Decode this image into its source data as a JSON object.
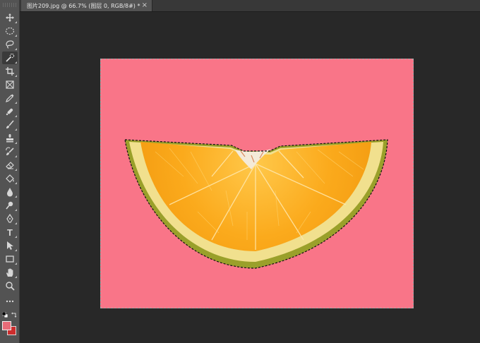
{
  "app": {
    "document_tab": {
      "title": "图片209.jpg @ 66.7% (图层 0, RGB/8#) *",
      "close_glyph": "×"
    }
  },
  "toolbar": {
    "tools": [
      {
        "name": "move-tool",
        "icon": "move-icon",
        "active": false
      },
      {
        "name": "elliptical-marquee-tool",
        "icon": "ellipse-marquee-icon",
        "active": false
      },
      {
        "name": "lasso-tool",
        "icon": "lasso-icon",
        "active": false
      },
      {
        "name": "quick-selection-tool",
        "icon": "quick-selection-icon",
        "active": true
      },
      {
        "name": "crop-tool",
        "icon": "crop-icon",
        "active": false
      },
      {
        "name": "frame-tool",
        "icon": "frame-icon",
        "active": false
      },
      {
        "name": "eyedropper-tool",
        "icon": "eyedropper-icon",
        "active": false
      },
      {
        "name": "healing-brush-tool",
        "icon": "healing-brush-icon",
        "active": false
      },
      {
        "name": "brush-tool",
        "icon": "brush-icon",
        "active": false
      },
      {
        "name": "clone-stamp-tool",
        "icon": "stamp-icon",
        "active": false
      },
      {
        "name": "history-brush-tool",
        "icon": "history-brush-icon",
        "active": false
      },
      {
        "name": "eraser-tool",
        "icon": "eraser-icon",
        "active": false
      },
      {
        "name": "paint-bucket-tool",
        "icon": "paint-bucket-icon",
        "active": false
      },
      {
        "name": "blur-tool",
        "icon": "drop-icon",
        "active": false
      },
      {
        "name": "dodge-tool",
        "icon": "dodge-icon",
        "active": false
      },
      {
        "name": "pen-tool",
        "icon": "pen-icon",
        "active": false
      },
      {
        "name": "type-tool",
        "icon": "type-icon",
        "active": false
      },
      {
        "name": "path-selection-tool",
        "icon": "arrow-icon",
        "active": false
      },
      {
        "name": "rectangle-tool",
        "icon": "rectangle-icon",
        "active": false
      },
      {
        "name": "hand-tool",
        "icon": "hand-icon",
        "active": false
      },
      {
        "name": "zoom-tool",
        "icon": "zoom-icon",
        "active": false
      },
      {
        "name": "edit-toolbar",
        "icon": "more-icon",
        "active": false
      }
    ],
    "type_glyph": "T",
    "foreground_color": "#e86b78",
    "background_color": "#cc2d2d"
  },
  "canvas": {
    "background_color": "#f97588",
    "zoom": "66.7%"
  }
}
